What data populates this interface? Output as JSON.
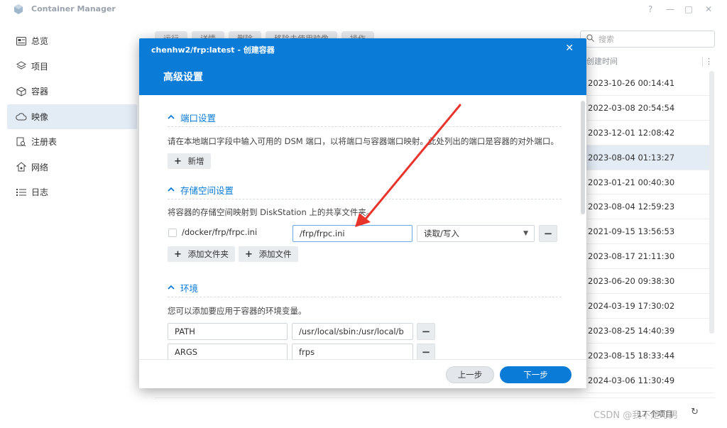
{
  "app": {
    "title": "Container Manager",
    "help_glyph": "?",
    "minimize_glyph": "—",
    "maximize_glyph": "□",
    "close_glyph": "✕"
  },
  "sidebar": {
    "items": [
      {
        "label": "总览",
        "icon": "overview-icon"
      },
      {
        "label": "项目",
        "icon": "layers-icon"
      },
      {
        "label": "容器",
        "icon": "container-icon"
      },
      {
        "label": "映像",
        "icon": "cloud-icon",
        "active": true
      },
      {
        "label": "注册表",
        "icon": "registry-icon"
      },
      {
        "label": "网络",
        "icon": "network-icon"
      },
      {
        "label": "日志",
        "icon": "list-icon"
      }
    ]
  },
  "background_toolbar": {
    "buttons": [
      "运行",
      "详情",
      "删除",
      "移除未使用映像",
      "操作"
    ]
  },
  "search": {
    "placeholder": "搜索"
  },
  "table": {
    "column_header": "创建时间",
    "more_glyph": "⋮",
    "rows": [
      "2023-10-26 00:14:41",
      "2022-03-08 20:54:54",
      "2023-12-01 12:08:42",
      "2023-08-04 01:13:27",
      "2023-01-21 00:40:30",
      "2023-08-04 12:59:23",
      "2021-09-15 13:56:53",
      "2023-08-17 21:11:30",
      "2023-06-20 09:38:30",
      "2024-03-19 17:30:02",
      "2023-08-25 14:40:39",
      "2023-08-15 18:33:44",
      "2024-03-06 11:30:49"
    ],
    "selected_index": 3
  },
  "footer_bar": {
    "count": "17 个项目",
    "refresh_glyph": "↻"
  },
  "dialog": {
    "title": "chenhw2/frp:latest - 创建容器",
    "close_glyph": "✕",
    "subtitle": "高级设置",
    "port_section": {
      "title": "端口设置",
      "description": "请在本地端口字段中输入可用的 DSM 端口，以将端口与容器端口映射。此处列出的端口是容器的对外端口。",
      "add_label": "新增"
    },
    "storage_section": {
      "title": "存储空间设置",
      "description": "将容器的存储空间映射到 DiskStation 上的共享文件夹。",
      "host_path": "/docker/frp/frpc.ini",
      "mount_path": "/frp/frpc.ini",
      "permission": "读取/写入",
      "add_folder_label": "添加文件夹",
      "add_file_label": "添加文件"
    },
    "env_section": {
      "title": "环境",
      "description": "您可以添加要应用于容器的环境变量。",
      "vars": [
        {
          "name": "PATH",
          "value": "/usr/local/sbin:/usr/local/b"
        },
        {
          "name": "ARGS",
          "value": "frps"
        }
      ]
    },
    "prev_label": "上一步",
    "next_label": "下一步"
  },
  "watermark": "CSDN @我不是叮男",
  "colors": {
    "accent": "#0a7bd6",
    "selected_row": "#e3ebf5",
    "arrow": "#e8352b"
  }
}
